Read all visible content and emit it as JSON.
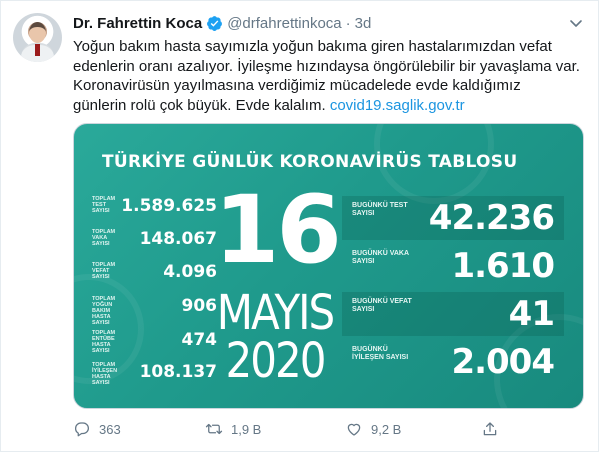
{
  "author": {
    "name": "Dr. Fahrettin Koca",
    "handle": "@drfahrettinkoca",
    "separator": "·",
    "time": "3d"
  },
  "tweet": {
    "lines": [
      "Yoğun bakım hasta sayımızla yoğun bakıma giren hastalarımızdan vefat",
      "edenlerin oranı azalıyor. İyileşme hızındaysa öngörülebilir bir yavaşlama var.",
      "Koronavirüsün yayılmasına verdiğimiz mücadelede evde kaldığımız",
      "günlerin rolü çok büyük. Evde kalalım."
    ],
    "link": "covid19.saglik.gov.tr"
  },
  "card": {
    "title": "TÜRKİYE GÜNLÜK KORONAVİRÜS TABLOSU",
    "day": "16",
    "month": "MAYIS",
    "year": "2020",
    "left_stats": [
      {
        "label": "TOPLAM TEST SAYISI",
        "value": "1.589.625"
      },
      {
        "label": "TOPLAM VAKA SAYISI",
        "value": "148.067"
      },
      {
        "label": "TOPLAM VEFAT SAYISI",
        "value": "4.096"
      },
      {
        "label": "TOPLAM YOĞUN BAKIM HASTA SAYISI",
        "value": "906"
      },
      {
        "label": "TOPLAM ENTÜBE HASTA SAYISI",
        "value": "474"
      },
      {
        "label": "TOPLAM İYİLEŞEN HASTA SAYISI",
        "value": "108.137"
      }
    ],
    "right_stats": [
      {
        "label": "BUGÜNKÜ TEST SAYISI",
        "value": "42.236"
      },
      {
        "label": "BUGÜNKÜ VAKA SAYISI",
        "value": "1.610"
      },
      {
        "label": "BUGÜNKÜ VEFAT SAYISI",
        "value": "41"
      },
      {
        "label": "BUGÜNKÜ İYİLEŞEN SAYISI",
        "value": "2.004"
      }
    ]
  },
  "actions": {
    "replies": "363",
    "retweets": "1,9 B",
    "likes": "9,2 B"
  },
  "colors": {
    "card_bg": "#1f9a8c",
    "link": "#1b95e0",
    "verified": "#1da1f2",
    "muted": "#657786"
  },
  "icons": [
    "verified-badge-icon",
    "chevron-down-icon",
    "reply-icon",
    "retweet-icon",
    "like-icon",
    "share-icon"
  ]
}
